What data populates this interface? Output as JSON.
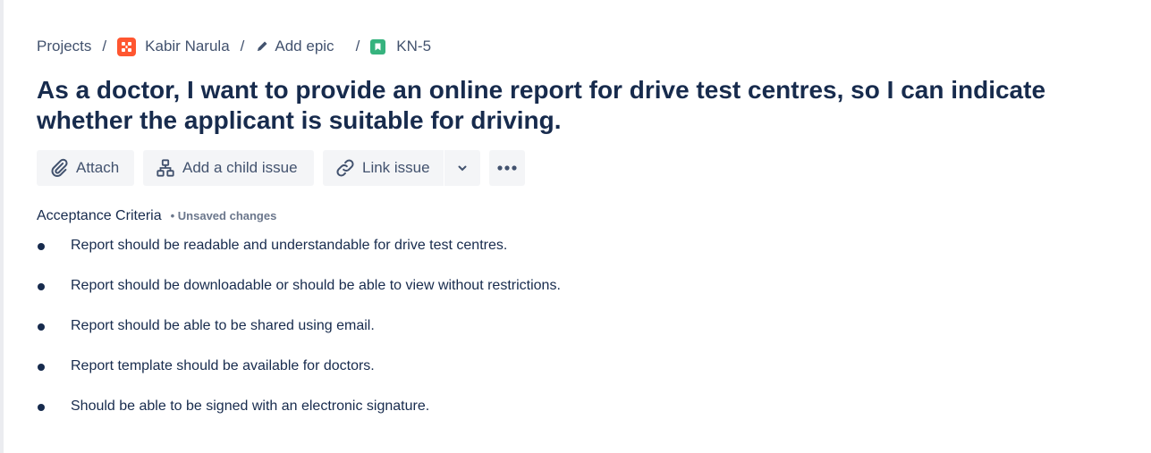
{
  "breadcrumb": {
    "projects_label": "Projects",
    "separator": "/",
    "project_name": "Kabir Narula",
    "epic_label": "Add epic",
    "issue_key": "KN-5"
  },
  "issue": {
    "title": "As a doctor, I want to provide an online report for drive test centres, so I can indicate whether the applicant is suitable for driving."
  },
  "toolbar": {
    "attach_label": "Attach",
    "child_issue_label": "Add a child issue",
    "link_issue_label": "Link issue"
  },
  "acceptance_criteria": {
    "label": "Acceptance Criteria",
    "status": "• Unsaved changes",
    "items": [
      "Report should be readable and understandable for drive test centres.",
      "Report should be downloadable or should be able to view without restrictions.",
      "Report should be able to be shared using email.",
      "Report template should be available for doctors.",
      "Should be able to be signed with an electronic signature."
    ]
  },
  "icons": {
    "project_avatar": "project-avatar-icon",
    "epic": "pencil-icon",
    "issue_type": "story-icon",
    "attach": "paperclip-icon",
    "child": "hierarchy-icon",
    "link": "link-icon",
    "dropdown": "chevron-down-icon",
    "more": "more-horizontal-icon"
  },
  "colors": {
    "project_avatar": "#ff5630",
    "story": "#36b37e",
    "text_primary": "#172b4d",
    "text_secondary": "#42526e",
    "button_bg": "#f4f5f7"
  }
}
